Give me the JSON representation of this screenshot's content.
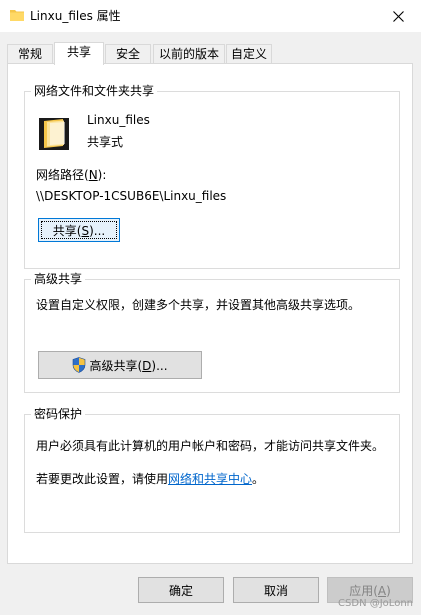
{
  "window": {
    "title": "Linxu_files 属性"
  },
  "tabs": [
    {
      "label": "常规",
      "active": false
    },
    {
      "label": "共享",
      "active": true
    },
    {
      "label": "安全",
      "active": false
    },
    {
      "label": "以前的版本",
      "active": false
    },
    {
      "label": "自定义",
      "active": false
    }
  ],
  "network_share": {
    "group_title": "网络文件和文件夹共享",
    "folder_name": "Linxu_files",
    "share_status": "共享式",
    "path_label_prefix": "网络路径(",
    "path_label_key": "N",
    "path_label_suffix": "):",
    "path_value": "\\\\DESKTOP-1CSUB6E\\Linxu_files",
    "share_button_prefix": "共享(",
    "share_button_key": "S",
    "share_button_suffix": ")..."
  },
  "advanced_share": {
    "group_title": "高级共享",
    "description": "设置自定义权限，创建多个共享，并设置其他高级共享选项。",
    "button_prefix": "高级共享(",
    "button_key": "D",
    "button_suffix": ")..."
  },
  "password_protect": {
    "group_title": "密码保护",
    "description": "用户必须具有此计算机的用户帐户和密码，才能访问共享文件夹。",
    "change_prefix": "若要更改此设置，请使用",
    "change_link": "网络和共享中心",
    "change_suffix": "。"
  },
  "footer": {
    "ok": "确定",
    "cancel": "取消",
    "apply_prefix": "应用(",
    "apply_key": "A",
    "apply_suffix": ")"
  },
  "watermark": "CSDN @JoLonn",
  "colors": {
    "accent": "#0078d7",
    "link": "#0066cc",
    "folder": "#f5c64a"
  }
}
